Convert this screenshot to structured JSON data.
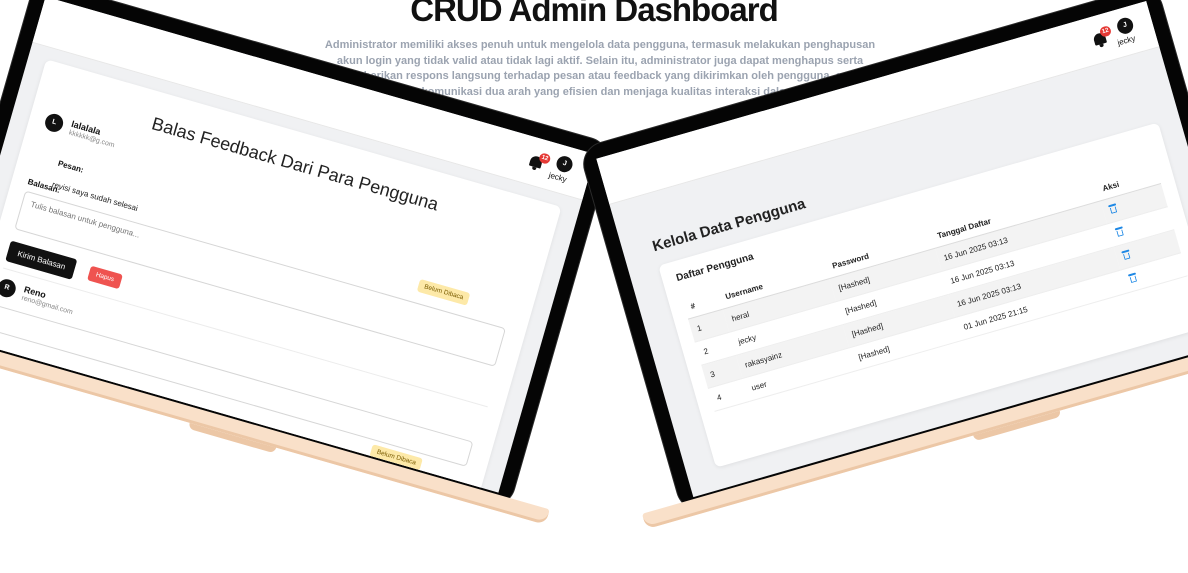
{
  "hero": {
    "title": "CRUD Admin Dashboard",
    "description": "Administrator memiliki akses penuh untuk mengelola data pengguna, termasuk melakukan penghapusan akun login yang tidak valid atau tidak lagi aktif. Selain itu, administrator juga dapat menghapus serta memberikan respons langsung terhadap pesan atau feedback yang dikirimkan oleh pengguna, guna memastikan komunikasi dua arah yang efisien dan menjaga kualitas interaksi dalam platform."
  },
  "feedback_screen": {
    "notification_count": "12",
    "user_initial": "J",
    "user_name": "jecky",
    "title": "Balas Feedback Dari Para Pengguna",
    "messages": [
      {
        "initial": "L",
        "name": "lalalala",
        "email": "kkkkkk@g.com",
        "pesan_label": "Pesan:",
        "pesan": "revisi saya sudah selesai",
        "status": "Belum Dibaca",
        "balasan_label": "Balasan:",
        "reply_placeholder": "Tulis balasan untuk pengguna...",
        "send_label": "Kirim Balasan",
        "delete_label": "Hapus"
      },
      {
        "initial": "R",
        "name": "Reno",
        "email": "reno@gmail.com",
        "status": "Belum Dibaca"
      }
    ]
  },
  "admin_screen": {
    "notification_count": "12",
    "user_initial": "J",
    "user_name": "jecky",
    "heading": "Kelola Data Pengguna",
    "card_title": "Daftar Pengguna",
    "columns": [
      "#",
      "Username",
      "Password",
      "Tanggal Daftar",
      "Aksi"
    ],
    "rows": [
      {
        "no": "1",
        "username": "heral",
        "password": "[Hashed]",
        "date": "16 Jun 2025 03:13"
      },
      {
        "no": "2",
        "username": "jecky",
        "password": "[Hashed]",
        "date": "16 Jun 2025 03:13"
      },
      {
        "no": "3",
        "username": "rakasyainz",
        "password": "[Hashed]",
        "date": "16 Jun 2025 03:13"
      },
      {
        "no": "4",
        "username": "user",
        "password": "[Hashed]",
        "date": "01 Jun 2025 21:15"
      }
    ],
    "action_icon": "trash-icon",
    "accent_color": "#1e88e5"
  }
}
